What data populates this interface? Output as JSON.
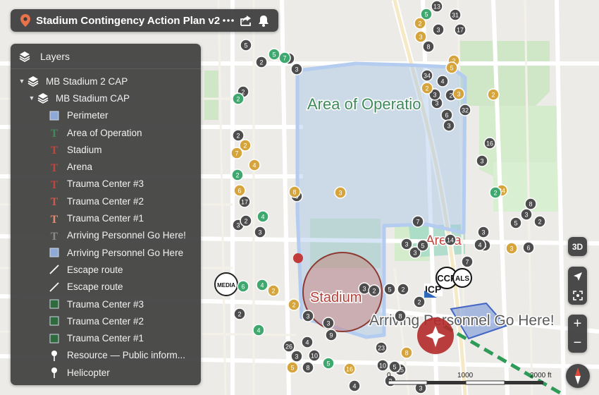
{
  "app": {
    "title": "Stadium Contingency Action Plan v2",
    "more_icon": "more-icon",
    "share_icon": "share-icon",
    "bell_icon": "bell-icon",
    "pin_icon": "location-pin-icon",
    "accent": "#e8734a"
  },
  "layers_panel": {
    "title": "Layers",
    "items": [
      {
        "label": "MB Stadium 2 CAP",
        "level": 0,
        "caret": "▼",
        "icon": "layers-icon"
      },
      {
        "label": "MB Stadium CAP",
        "level": 1,
        "caret": "▼",
        "icon": "layers-icon"
      },
      {
        "label": "Perimeter",
        "level": 2,
        "icon": "square-blue",
        "color": "#8fa9d6"
      },
      {
        "label": "Area of Operation",
        "level": 2,
        "icon": "text-green",
        "color": "#3f8a5a"
      },
      {
        "label": "Stadium",
        "level": 2,
        "icon": "text-red",
        "color": "#c0463f"
      },
      {
        "label": "Arena",
        "level": 2,
        "icon": "text-red",
        "color": "#c0463f"
      },
      {
        "label": "Trauma Center #3",
        "level": 2,
        "icon": "text-red",
        "color": "#c0463f"
      },
      {
        "label": "Trauma Center #2",
        "level": 2,
        "icon": "text-red",
        "color": "#d0584f"
      },
      {
        "label": "Trauma Center #1",
        "level": 2,
        "icon": "text-salmon",
        "color": "#e58a70"
      },
      {
        "label": "Arriving Personnel Go Here!",
        "level": 2,
        "icon": "text-gray",
        "color": "#8a8a8a"
      },
      {
        "label": "Arriving Personnel Go Here",
        "level": 2,
        "icon": "square-blue",
        "color": "#8fa9d6"
      },
      {
        "label": "Escape route",
        "level": 2,
        "icon": "line-white",
        "color": "#ffffff"
      },
      {
        "label": "Escape route",
        "level": 2,
        "icon": "line-white",
        "color": "#ffffff"
      },
      {
        "label": "Trauma Center #3",
        "level": 2,
        "icon": "square-green",
        "color": "#2f6a3c"
      },
      {
        "label": "Trauma Center #2",
        "level": 2,
        "icon": "square-green",
        "color": "#2f6a3c"
      },
      {
        "label": "Trauma Center #1",
        "level": 2,
        "icon": "square-green",
        "color": "#2f6a3c"
      },
      {
        "label": "Resource — Public inform...",
        "level": 2,
        "icon": "pin-white",
        "color": "#ffffff"
      },
      {
        "label": "Helicopter",
        "level": 2,
        "icon": "pin-white",
        "color": "#ffffff"
      }
    ]
  },
  "map_labels": {
    "area": "Area of Operatio",
    "arena": "Arena",
    "stadium": "Stadium",
    "arriving": "Arriving Personnel Go Here!",
    "media": "MEDIA",
    "icp": "ICP",
    "ccp": "CCP",
    "als": "ALS"
  },
  "controls": {
    "three_d": "3D",
    "zoom_in": "+",
    "zoom_out": "−",
    "locate_icon": "locate-arrow-icon",
    "fit_icon": "fit-bounds-icon",
    "compass_icon": "compass-icon"
  },
  "scale": {
    "ticks": [
      "0",
      "1000",
      "2000 ft"
    ]
  },
  "markers": {
    "gray": [
      "13",
      "31",
      "3",
      "17",
      "8",
      "34",
      "4",
      "32",
      "3",
      "6",
      "3",
      "16",
      "3",
      "8",
      "3",
      "2",
      "5",
      "3",
      "4",
      "6",
      "7",
      "8",
      "26",
      "4",
      "10",
      "2",
      "8",
      "9",
      "4",
      "23",
      "10",
      "15",
      "2",
      "5",
      "2",
      "3",
      "3",
      "2",
      "2",
      "17",
      "3",
      "2",
      "3",
      "2",
      "3",
      "6",
      "3",
      "2",
      "5",
      "3",
      "2",
      "3",
      "5",
      "3",
      "2",
      "3",
      "5",
      "3",
      "3",
      "2",
      "4",
      "14",
      "7"
    ],
    "gold": [
      "2",
      "3",
      "2",
      "6",
      "8",
      "3",
      "2",
      "2",
      "24",
      "3",
      "8",
      "2",
      "5",
      "16",
      "8",
      "2",
      "4",
      "7",
      "3",
      "5",
      "2"
    ],
    "green": [
      "6",
      "5",
      "7",
      "2",
      "4",
      "4",
      "2",
      "5",
      "2",
      "5",
      "4"
    ],
    "colors": {
      "gray": "#4d4d4d",
      "gold": "#d5a43c",
      "green": "#3fa86e",
      "blue": "#2f67b8",
      "red": "#c23b3b"
    }
  }
}
